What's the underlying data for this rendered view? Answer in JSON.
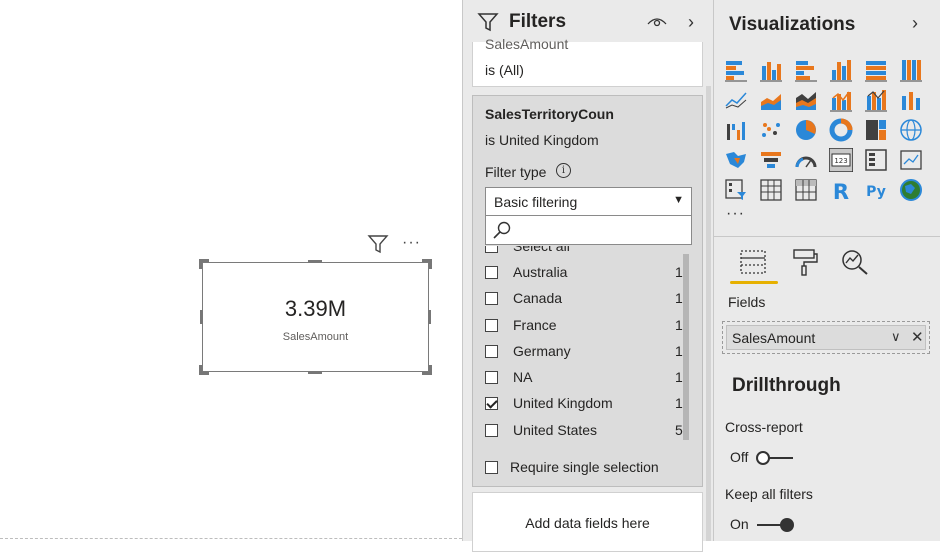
{
  "card_visual": {
    "value": "3.39M",
    "label": "SalesAmount"
  },
  "filters_pane": {
    "title": "Filters",
    "card1": {
      "field": "SalesAmount",
      "condition": "is (All)"
    },
    "card2": {
      "field": "SalesTerritoryCoun",
      "condition": "is United Kingdom",
      "filter_type_label": "Filter type",
      "filter_type_value": "Basic filtering",
      "select_all": "Select all",
      "items": [
        {
          "label": "Australia",
          "count": "1",
          "checked": false
        },
        {
          "label": "Canada",
          "count": "1",
          "checked": false
        },
        {
          "label": "France",
          "count": "1",
          "checked": false
        },
        {
          "label": "Germany",
          "count": "1",
          "checked": false
        },
        {
          "label": "NA",
          "count": "1",
          "checked": false
        },
        {
          "label": "United Kingdom",
          "count": "1",
          "checked": true
        },
        {
          "label": "United States",
          "count": "5",
          "checked": false
        }
      ],
      "require_single": "Require single selection"
    },
    "add_fields": "Add data fields here"
  },
  "visualizations_pane": {
    "title": "Visualizations",
    "more": "···",
    "fields_label": "Fields",
    "field_well_value": "SalesAmount",
    "drillthrough_title": "Drillthrough",
    "cross_report_label": "Cross-report",
    "cross_report_state": "Off",
    "keep_filters_label": "Keep all filters",
    "keep_filters_state": "On",
    "icons": [
      "stacked-bar-chart-icon",
      "stacked-column-chart-icon",
      "clustered-bar-chart-icon",
      "clustered-column-chart-icon",
      "100-stacked-bar-chart-icon",
      "100-stacked-column-chart-icon",
      "line-chart-icon",
      "area-chart-icon",
      "stacked-area-chart-icon",
      "line-clustered-column-icon",
      "line-stacked-column-icon",
      "ribbon-chart-icon",
      "waterfall-chart-icon",
      "scatter-chart-icon",
      "pie-chart-icon",
      "donut-chart-icon",
      "treemap-icon",
      "map-icon",
      "filled-map-icon",
      "funnel-icon",
      "gauge-icon",
      "card-icon",
      "multi-row-card-icon",
      "kpi-icon",
      "slicer-icon",
      "table-icon",
      "matrix-icon",
      "r-visual-icon",
      "python-visual-icon",
      "arcgis-map-icon"
    ]
  },
  "colors": {
    "accent": "#e6b000",
    "blue": "#2b88d8",
    "orange": "#e8771d",
    "dark": "#404040"
  }
}
